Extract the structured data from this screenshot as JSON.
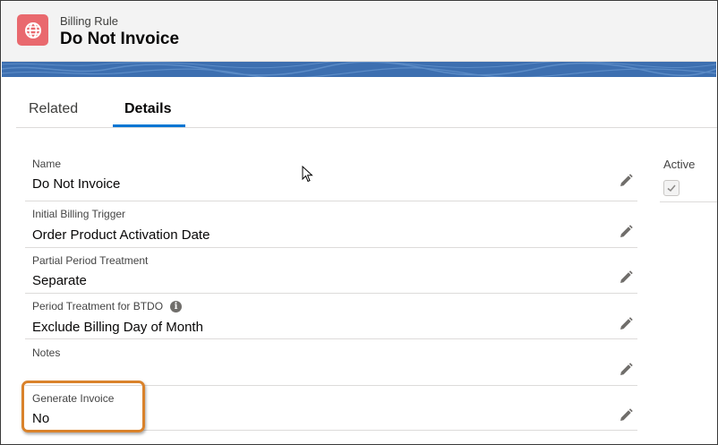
{
  "header": {
    "eyebrow": "Billing Rule",
    "title": "Do Not Invoice",
    "icon": "globe-icon",
    "icon_color": "#e9696e"
  },
  "tabs": [
    {
      "label": "Related",
      "active": false
    },
    {
      "label": "Details",
      "active": true
    }
  ],
  "fields": [
    {
      "label": "Name",
      "value": "Do Not Invoice"
    },
    {
      "label": "Initial Billing Trigger",
      "value": "Order Product Activation Date"
    },
    {
      "label": "Partial Period Treatment",
      "value": "Separate"
    },
    {
      "label": "Period Treatment for BTDO",
      "value": "Exclude Billing Day of Month",
      "info_icon": "i"
    },
    {
      "label": "Notes",
      "value": ""
    },
    {
      "label": "Generate Invoice",
      "value": "No"
    }
  ],
  "side": {
    "active_label": "Active",
    "active_checked": true
  },
  "colors": {
    "accent": "#0176d3",
    "banner": "#3d6fb0",
    "highlight": "#d9822b"
  }
}
